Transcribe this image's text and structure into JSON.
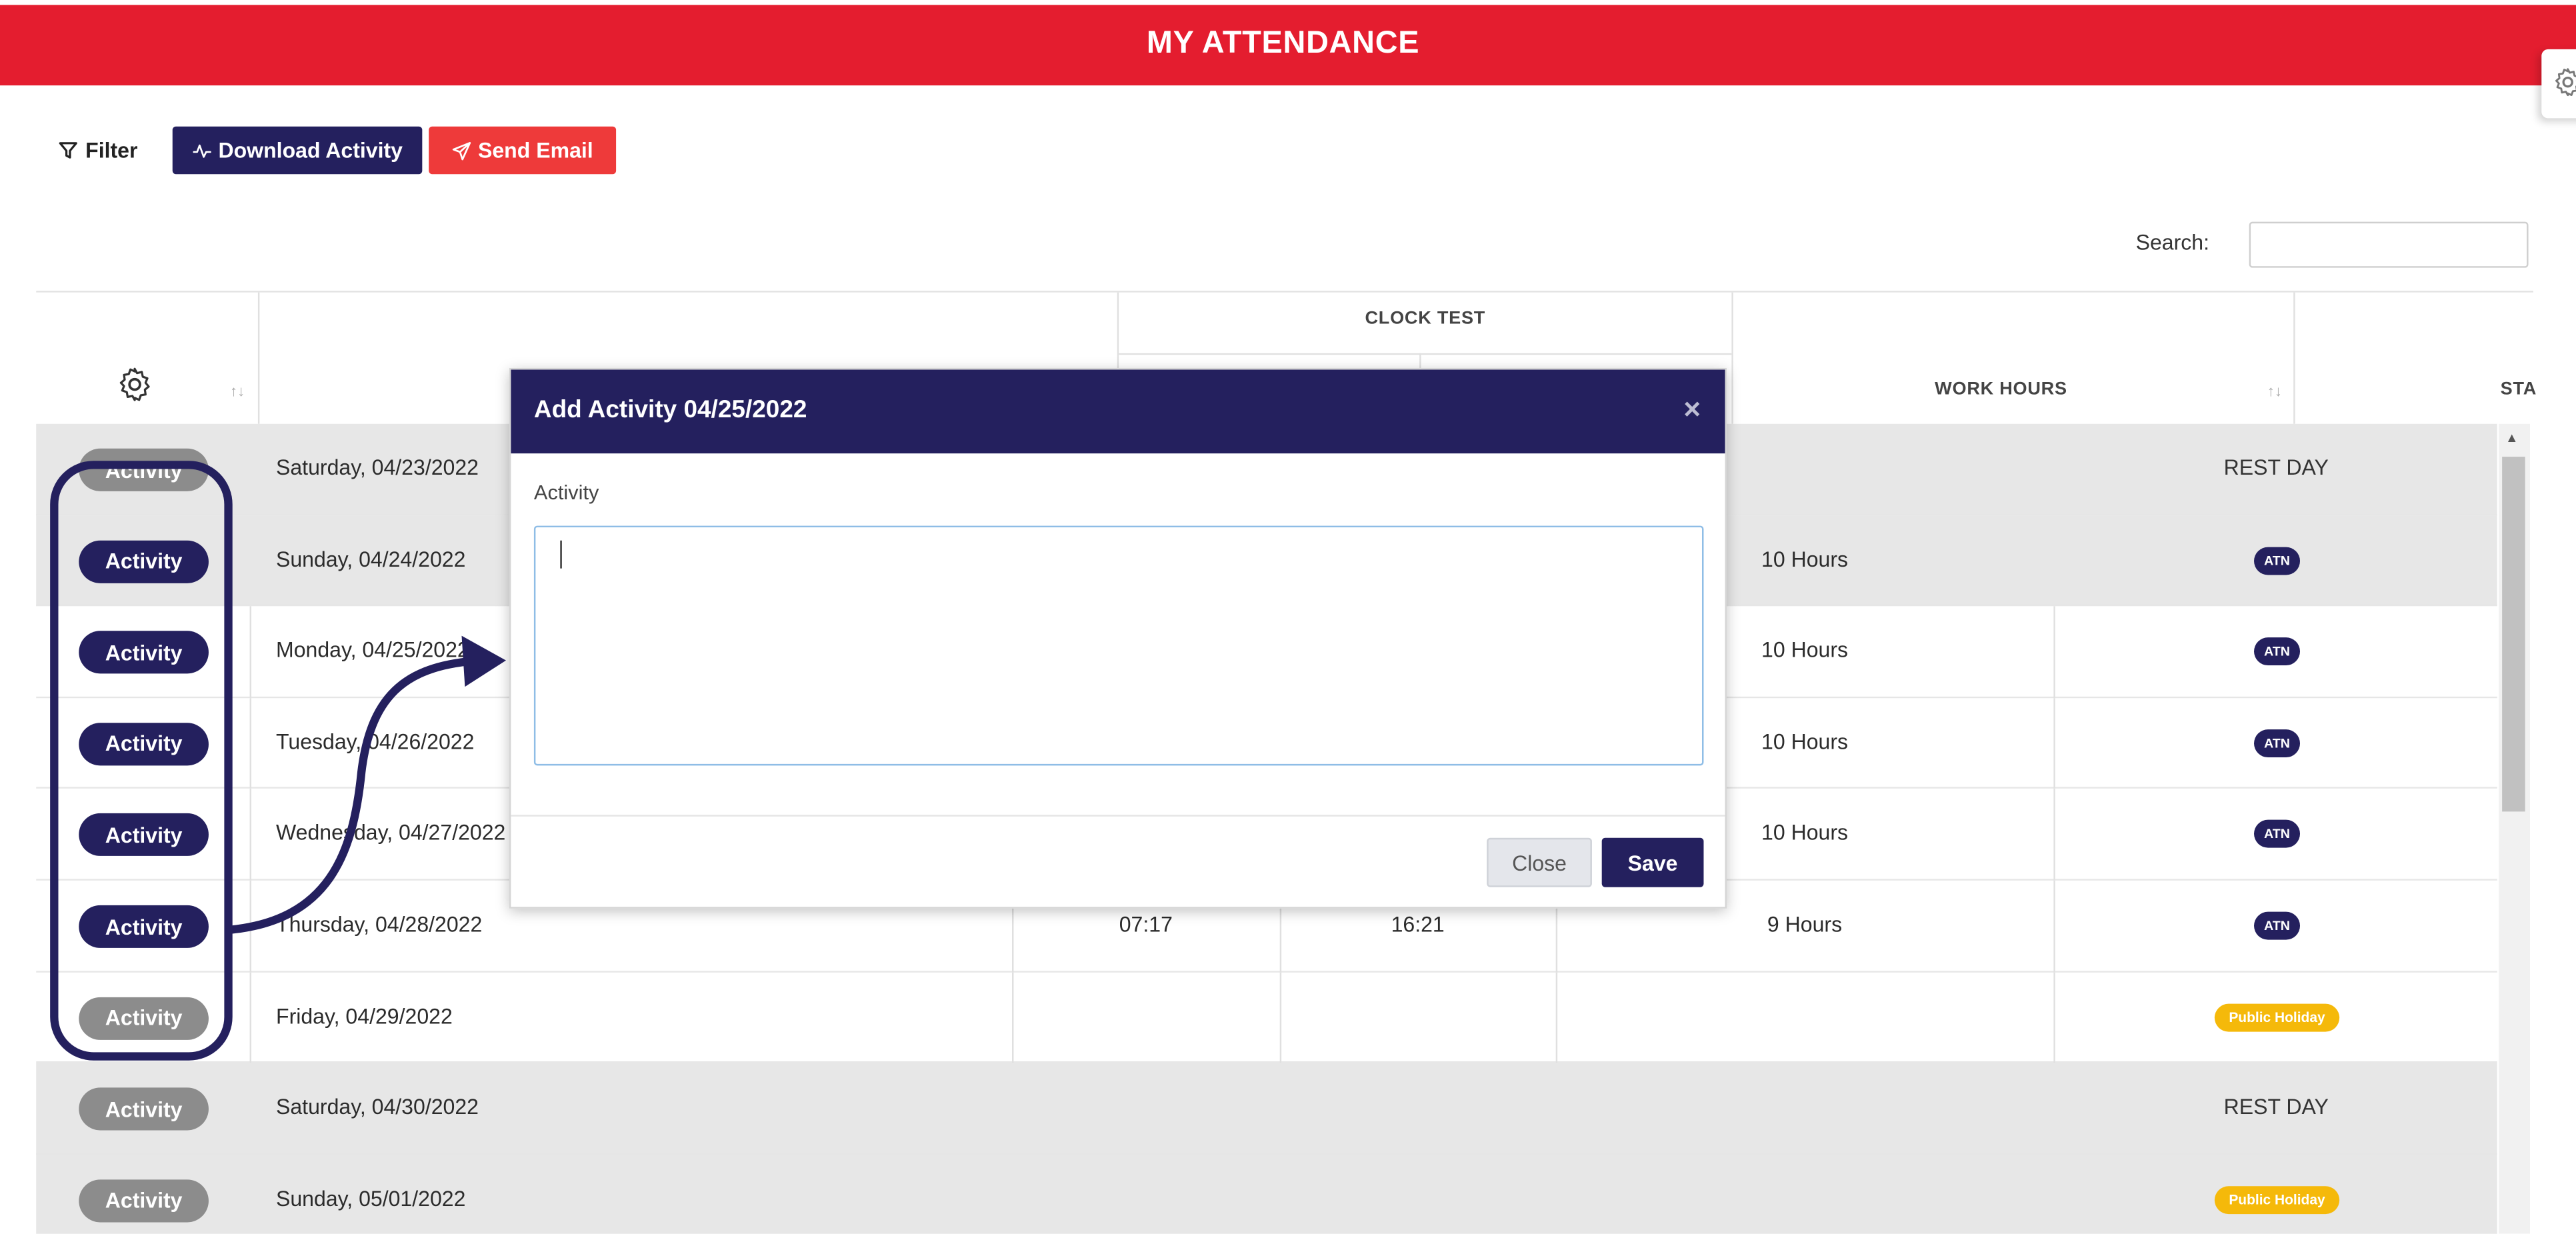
{
  "header": {
    "title": "MY ATTENDANCE"
  },
  "toolbar": {
    "filter_label": "Filter",
    "download_label": "Download Activity",
    "email_label": "Send Email"
  },
  "search": {
    "label": "Search:",
    "value": ""
  },
  "table": {
    "group_header": "CLOCK TEST",
    "work_hours_header": "WORK HOURS",
    "status_header_partial": "STA",
    "rows": [
      {
        "action": "Activity",
        "date": "Saturday, 04/23/2022",
        "clock_in": "",
        "clock_out": "",
        "hours": "",
        "status": "REST DAY",
        "status_type": "text"
      },
      {
        "action": "Activity",
        "date": "Sunday, 04/24/2022",
        "clock_in": "",
        "clock_out": "",
        "hours": "10 Hours",
        "status": "ATN",
        "status_type": "atn"
      },
      {
        "action": "Activity",
        "date": "Monday, 04/25/2022",
        "clock_in": "",
        "clock_out": "",
        "hours": "10 Hours",
        "status": "ATN",
        "status_type": "atn"
      },
      {
        "action": "Activity",
        "date": "Tuesday, 04/26/2022",
        "clock_in": "",
        "clock_out": "",
        "hours": "10 Hours",
        "status": "ATN",
        "status_type": "atn"
      },
      {
        "action": "Activity",
        "date": "Wednesday, 04/27/2022",
        "clock_in": "",
        "clock_out": "",
        "hours": "10 Hours",
        "status": "ATN",
        "status_type": "atn"
      },
      {
        "action": "Activity",
        "date": "Thursday, 04/28/2022",
        "clock_in": "07:17",
        "clock_out": "16:21",
        "hours": "9 Hours",
        "status": "ATN",
        "status_type": "atn"
      },
      {
        "action": "Activity",
        "date": "Friday, 04/29/2022",
        "clock_in": "",
        "clock_out": "",
        "hours": "",
        "status": "Public Holiday",
        "status_type": "holiday"
      },
      {
        "action": "Activity",
        "date": "Saturday, 04/30/2022",
        "clock_in": "",
        "clock_out": "",
        "hours": "",
        "status": "REST DAY",
        "status_type": "text"
      },
      {
        "action": "Activity",
        "date": "Sunday, 05/01/2022",
        "clock_in": "",
        "clock_out": "",
        "hours": "",
        "status": "Public Holiday",
        "status_type": "holiday"
      }
    ]
  },
  "modal": {
    "title": "Add Activity 04/25/2022",
    "close_x": "×",
    "field_label": "Activity",
    "field_value": "",
    "close_label": "Close",
    "save_label": "Save"
  },
  "colors": {
    "header_red": "#e41d2f",
    "navy": "#24205e",
    "email_red": "#ee3a3a",
    "holiday_yellow": "#f5b90a",
    "row_gray": "#e7e7e7"
  },
  "icons": [
    "filter-icon",
    "activity-pulse-icon",
    "send-icon",
    "gear-icon",
    "sort-icon",
    "close-icon"
  ]
}
